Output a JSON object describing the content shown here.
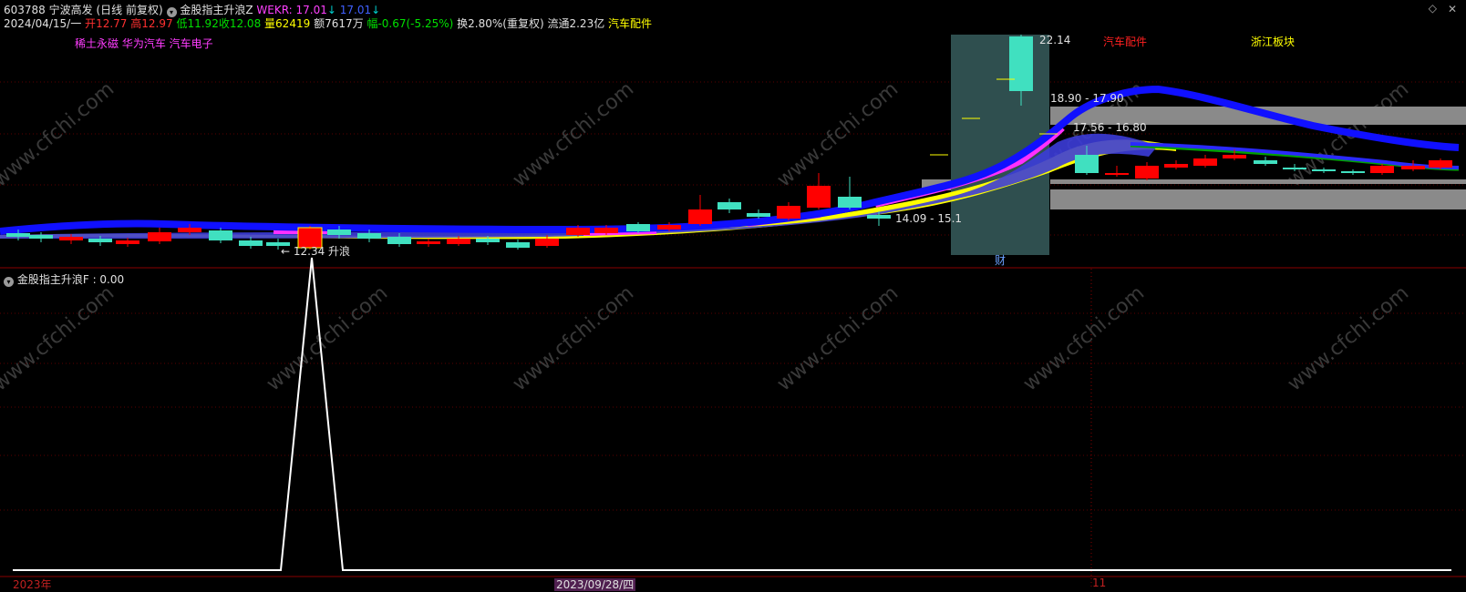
{
  "header": {
    "stock_code": "603788",
    "stock_name": "宁波高发",
    "period": "(日线 前复权)",
    "indicator_name": "金股指主升浪Z",
    "wekr_label": "WEKR: 17.01",
    "wekr_arrow": "↓",
    "wekr_value2": "17.01",
    "wekr_arrow2": "↓"
  },
  "quote": {
    "date": "2024/04/15/一",
    "open_label": "开",
    "open": "12.77",
    "high_label": "高",
    "high": "12.97",
    "low_label": "低",
    "low": "11.92",
    "close_label": "收",
    "close": "12.08",
    "volume_label": "量",
    "volume": "62419",
    "amount": "额7617万",
    "change_label": "幅",
    "change": "-0.67(-5.25%)",
    "turnover": "换2.80%(重复权)",
    "float_cap": "流通2.23亿",
    "sector": "汽车配件"
  },
  "concepts": "稀土永磁 华为汽车 汽车电子",
  "chart_annotations": {
    "peak_price": "22.14",
    "range1": "18.90 - 17.90",
    "range2": "17.56 - 16.80",
    "range3": "14.09 - 15.1",
    "low_price": "← 12.34 升浪",
    "sector_label1": "汽车配件",
    "sector_label2": "浙江板块",
    "finance_marker": "财"
  },
  "sub_panel": {
    "indicator_label": "金股指主升浪F",
    "value": ": 0.00"
  },
  "date_axis": {
    "year": "2023年",
    "cursor_date": "2023/09/28/四",
    "month": "11"
  },
  "colors": {
    "background": "#000000",
    "up": "#ff0000",
    "down": "#40e0c0",
    "blue_band": "#1a1aff",
    "yellow_band": "#ffff00",
    "magenta_band": "#ff30ff",
    "watermark": "#4a4a4a"
  },
  "watermark": "www.cfchi.com",
  "icons": {
    "window_close": "close-icon",
    "window_restore": "diamond-icon",
    "header_dropdown": "chevron-down-icon"
  }
}
